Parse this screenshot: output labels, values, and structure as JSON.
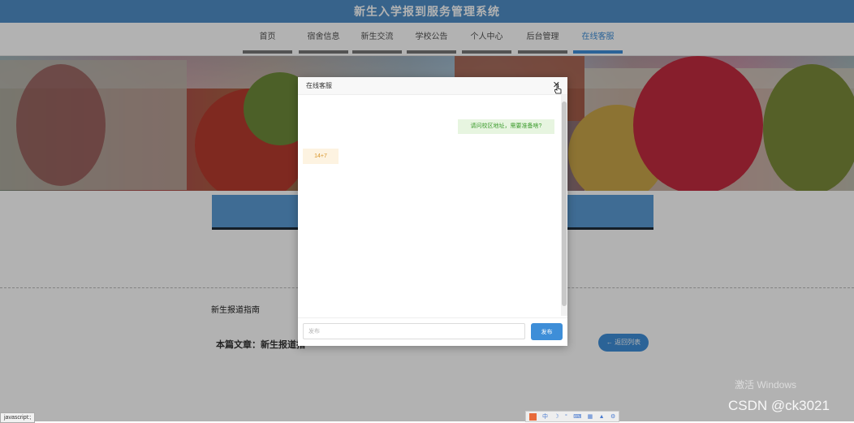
{
  "header": {
    "title": "新生入学报到服务管理系统"
  },
  "nav": {
    "items": [
      {
        "label": "首页",
        "active": false
      },
      {
        "label": "宿舍信息",
        "active": false
      },
      {
        "label": "新生交流",
        "active": false
      },
      {
        "label": "学校公告",
        "active": false
      },
      {
        "label": "个人中心",
        "active": false
      },
      {
        "label": "后台管理",
        "active": false
      },
      {
        "label": "在线客服",
        "active": true
      }
    ]
  },
  "article": {
    "title": "新生报道指南",
    "this_article_label": "本篇文章：新生报道指",
    "back_button_label": "返回列表"
  },
  "chat_modal": {
    "title": "在线客服",
    "close_label": "✕",
    "messages": [
      {
        "side": "right",
        "text": "请问校区地址，需要准备啥?"
      },
      {
        "side": "left",
        "text": "14+7"
      }
    ],
    "input_placeholder": "发布",
    "send_label": "发布"
  },
  "status": {
    "text": "javascript:;"
  },
  "watermarks": {
    "windows": "激活 Windows",
    "csdn": "CSDN @ck3021"
  },
  "ime": {
    "label": "中",
    "icon": "ime-logo-icon"
  },
  "colors": {
    "primary": "#3e8ed8",
    "header_bg": "#4f8fc8",
    "right_bubble": "#e7f5e0",
    "left_bubble": "#fdf3e1"
  }
}
